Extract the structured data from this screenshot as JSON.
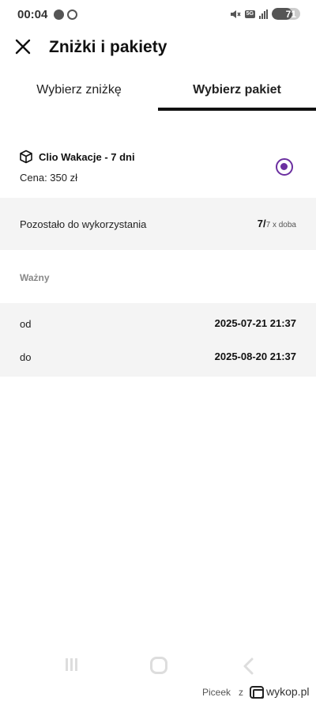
{
  "status_bar": {
    "time": "00:04",
    "network_badge": "5G",
    "battery_level": "71",
    "left_icons": [
      "facebook-icon",
      "app-notification-icon"
    ],
    "right_icons": [
      "mute-icon",
      "signal-icon",
      "battery-icon"
    ]
  },
  "header": {
    "title": "Zniżki i pakiety",
    "close_icon": "close-icon"
  },
  "tabs": [
    {
      "label": "Wybierz zniżkę",
      "active": false
    },
    {
      "label": "Wybierz pakiet",
      "active": true
    }
  ],
  "package": {
    "icon": "box-icon",
    "name": "Clio Wakacje - 7 dni",
    "price": "Cena: 350 zł",
    "selected": true
  },
  "remaining": {
    "label": "Pozostało do wykorzystania",
    "value": "7/",
    "value_sub": "7 x doba"
  },
  "valid": {
    "heading": "Ważny",
    "from_label": "od",
    "from_value": "2025-07-21 21:37",
    "to_label": "do",
    "to_value": "2025-08-20 21:37"
  },
  "nav_bar": {
    "icons": [
      "recents-icon",
      "home-icon",
      "back-icon"
    ]
  },
  "footer": {
    "username": "Piceek",
    "connector": "z",
    "site": "wykop.pl"
  },
  "colors": {
    "accent": "#6b2fa0",
    "section_bg": "#f4f4f4",
    "text": "#111111"
  }
}
